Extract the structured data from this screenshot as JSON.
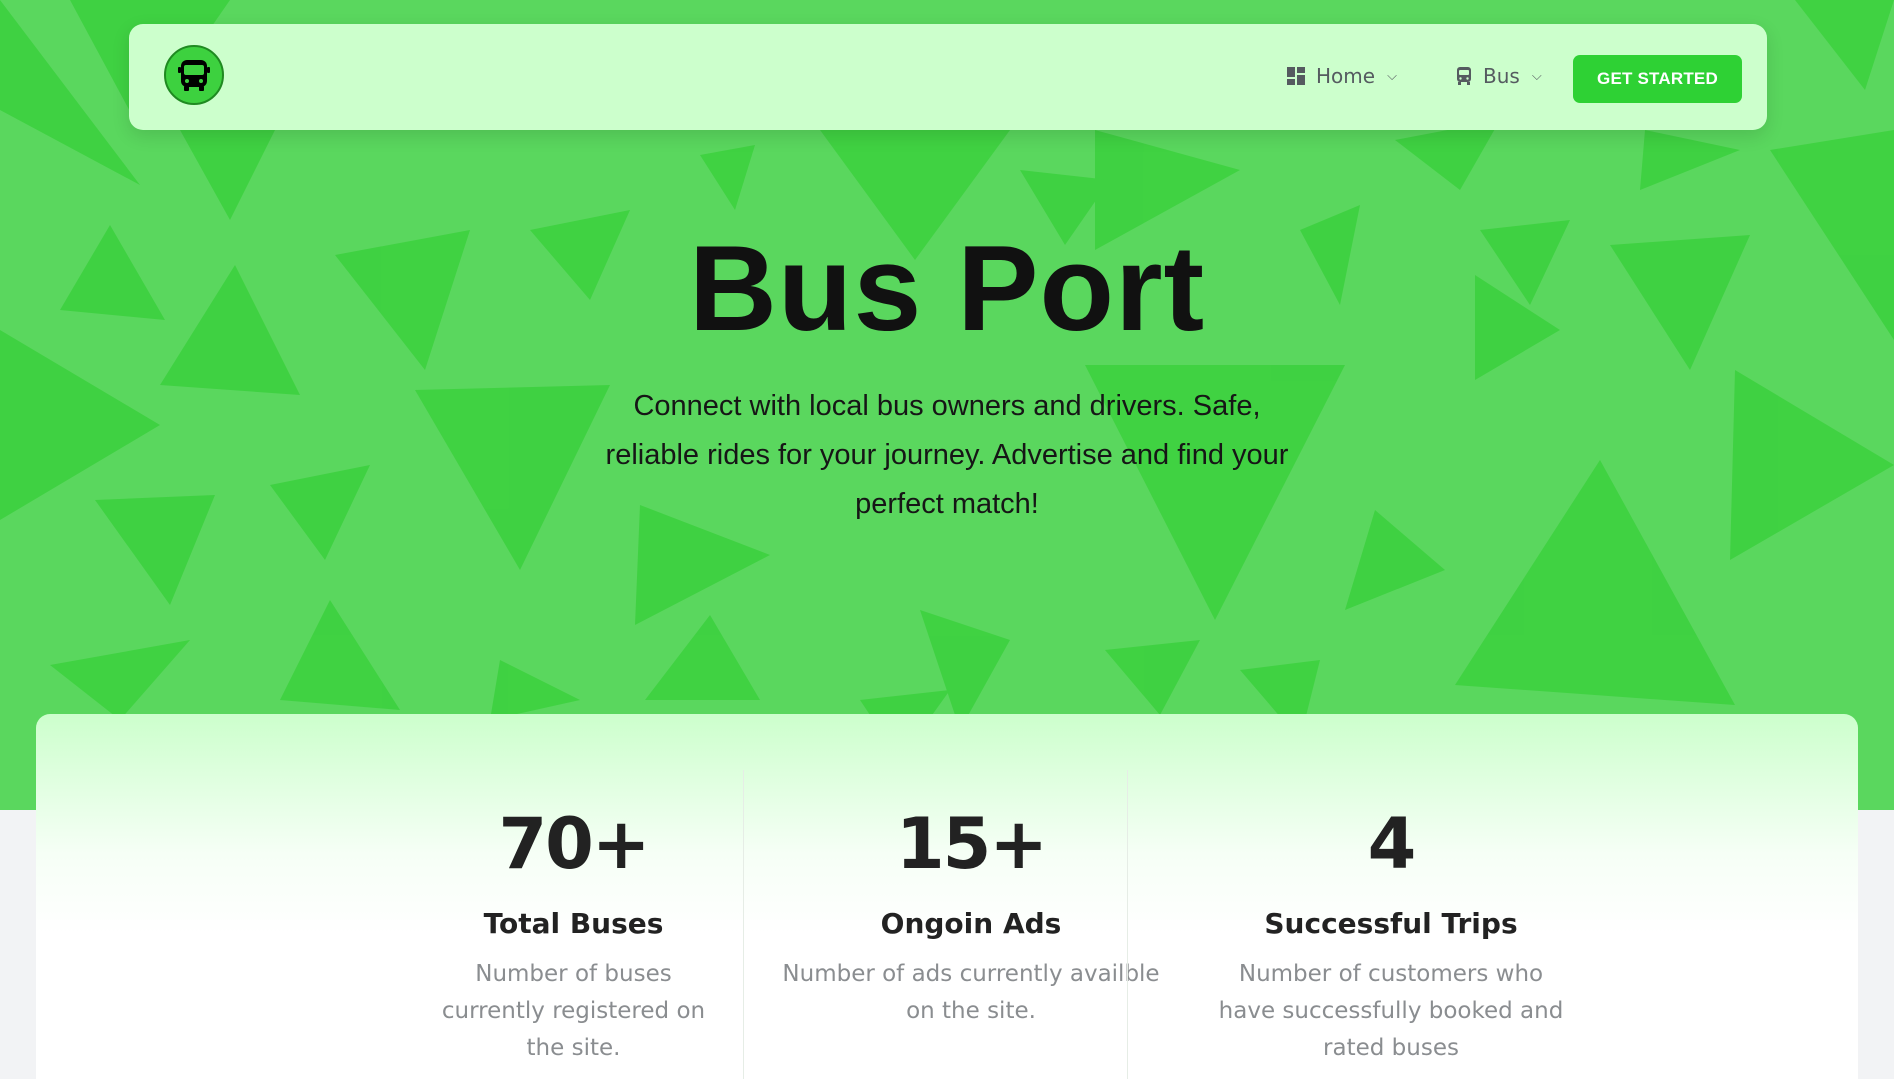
{
  "nav": {
    "logo_icon": "bus-icon",
    "items": [
      {
        "label": "Home",
        "icon": "dashboard-icon"
      },
      {
        "label": "Bus",
        "icon": "bus-icon"
      }
    ],
    "cta_label": "GET STARTED"
  },
  "hero": {
    "title": "Bus Port",
    "subtitle": "Connect with local bus owners and drivers. Safe, reliable rides for your journey. Advertise and find your perfect match!"
  },
  "stats": [
    {
      "value": "70+",
      "label": "Total Buses",
      "description": "Number of buses currently registered on the site."
    },
    {
      "value": "15+",
      "label": "Ongoin Ads",
      "description": "Number of ads currently availble on the site."
    },
    {
      "value": "4",
      "label": "Successful Trips",
      "description": "Number of customers who have successfully booked and rated buses"
    }
  ],
  "colors": {
    "hero_bg": "#5ad75e",
    "triangle_light": "#3dd13f",
    "navbar_bg": "#ccffcc",
    "cta_bg": "#2ed134"
  }
}
